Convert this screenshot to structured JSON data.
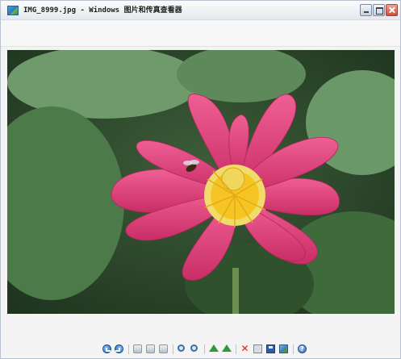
{
  "window": {
    "title": "IMG_8999.jpg - Windows 图片和传真查看器",
    "icon": "image-viewer-app-icon"
  },
  "title_buttons": [
    "minimize-icon",
    "maximize-icon",
    "close-icon"
  ],
  "viewer": {
    "image_description_icon": "photo-lotus",
    "colors": {
      "petal": "#e2477d",
      "center": "#f2cf2d",
      "leaf": "#4f7d4c",
      "background": "#2e4a2b"
    }
  },
  "toolbar": {
    "buttons": [
      "previous-image-icon",
      "next-image-icon",
      "best-fit-icon",
      "actual-size-icon",
      "slideshow-icon",
      "zoom-in-icon",
      "zoom-out-icon",
      "rotate-clockwise-icon",
      "rotate-counterclockwise-icon",
      "delete-icon",
      "print-icon",
      "save-icon",
      "open-for-editing-icon",
      "help-icon"
    ]
  }
}
